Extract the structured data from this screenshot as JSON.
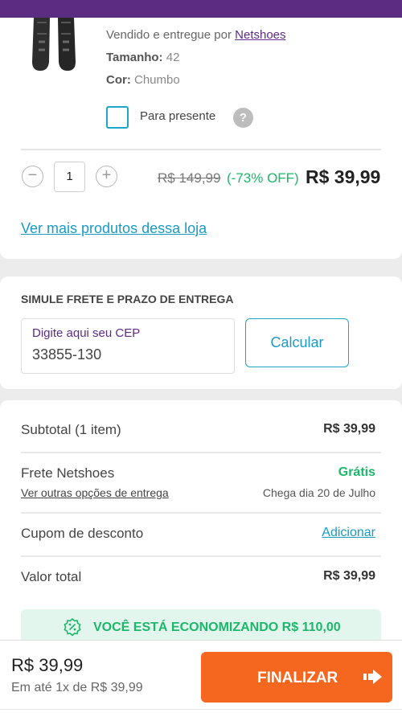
{
  "product": {
    "thumb_icon": "flip-flop-icon",
    "sold_by_prefix": "Vendido e entregue por",
    "sold_by_link": "Netshoes",
    "size_label": "Tamanho:",
    "size_value": "42",
    "color_label": "Cor:",
    "color_value": "Chumbo",
    "gift_label": "Para presente",
    "help_icon": "question-icon",
    "help_glyph": "?",
    "quantity": "1",
    "minus_glyph": "−",
    "plus_glyph": "+",
    "old_price": "R$ 149,99",
    "discount": "(-73% OFF)",
    "price": "R$ 39,99",
    "more_link": "Ver mais produtos dessa loja"
  },
  "shipping": {
    "title": "SIMULE FRETE E PRAZO DE ENTREGA",
    "cep_label": "Digite aqui seu CEP",
    "cep_value": "33855-130",
    "calc_button": "Calcular"
  },
  "summary": {
    "subtotal_label": "Subtotal (1 item)",
    "subtotal_value": "R$ 39,99",
    "freight_label": "Frete Netshoes",
    "freight_value": "Grátis",
    "freight_options_link": "Ver outras opções de entrega",
    "freight_arrival": "Chega dia 20 de Julho",
    "coupon_label": "Cupom de desconto",
    "coupon_action": "Adicionar",
    "total_label": "Valor total",
    "total_value": "R$ 39,99",
    "saving_icon": "percent-badge-icon",
    "saving_text": "VOCÊ ESTÁ ECONOMIZANDO R$ 110,00"
  },
  "footer": {
    "price": "R$ 39,99",
    "installment": "Em até 1x de R$ 39,99",
    "finalize_label": "FINALIZAR",
    "finalize_icon": "arrow-right-icon"
  },
  "colors": {
    "brand_purple": "#5b2c82",
    "accent_blue": "#1ea6c9",
    "success_green": "#1cb76a",
    "cta_orange": "#f5661f"
  }
}
